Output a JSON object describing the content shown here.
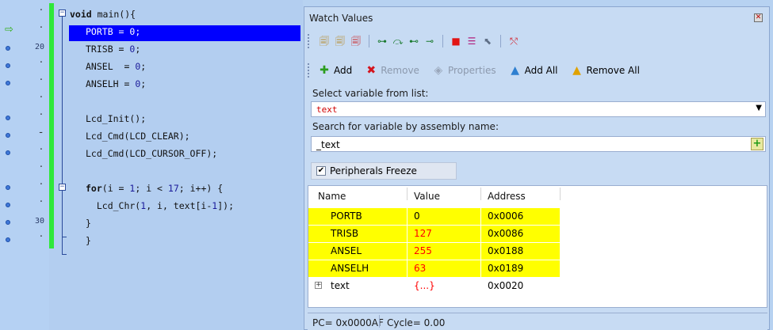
{
  "editor": {
    "lines": [
      {
        "gutter": "dot",
        "code": [
          {
            "t": "void",
            "kw": true
          },
          {
            "t": " main(){"
          }
        ]
      },
      {
        "gutter": "dot",
        "arrow": true,
        "code": [
          {
            "t": "PORTB = "
          },
          {
            "t": "0",
            "num": true
          },
          {
            "t": ";"
          }
        ],
        "highlight": true
      },
      {
        "gutter": "20",
        "bp": true,
        "code": [
          {
            "t": "TRISB = "
          },
          {
            "t": "0",
            "num": true
          },
          {
            "t": ";"
          }
        ]
      },
      {
        "gutter": "dot",
        "bp": true,
        "code": [
          {
            "t": "ANSEL  = "
          },
          {
            "t": "0",
            "num": true
          },
          {
            "t": ";"
          }
        ]
      },
      {
        "gutter": "dot",
        "bp": true,
        "code": [
          {
            "t": "ANSELH = "
          },
          {
            "t": "0",
            "num": true
          },
          {
            "t": ";"
          }
        ]
      },
      {
        "gutter": "dot",
        "code": []
      },
      {
        "gutter": "dot",
        "bp": true,
        "code": [
          {
            "t": "Lcd_Init();"
          }
        ]
      },
      {
        "gutter": "dash",
        "bp": true,
        "code": [
          {
            "t": "Lcd_Cmd(LCD_CLEAR);"
          }
        ]
      },
      {
        "gutter": "dot",
        "bp": true,
        "code": [
          {
            "t": "Lcd_Cmd(LCD_CURSOR_OFF);"
          }
        ]
      },
      {
        "gutter": "dot",
        "code": []
      },
      {
        "gutter": "dot",
        "bp": true,
        "code": [
          {
            "t": "for",
            "kw": true
          },
          {
            "t": "(i = "
          },
          {
            "t": "1",
            "num": true
          },
          {
            "t": "; i < "
          },
          {
            "t": "17",
            "num": true
          },
          {
            "t": "; i++) {"
          }
        ]
      },
      {
        "gutter": "dot",
        "bp": true,
        "code": [
          {
            "t": "  Lcd_Chr("
          },
          {
            "t": "1",
            "num": true
          },
          {
            "t": ", i, text[i-"
          },
          {
            "t": "1",
            "num": true
          },
          {
            "t": "]);"
          }
        ]
      },
      {
        "gutter": "30",
        "bp": true,
        "code": [
          {
            "t": "}"
          }
        ]
      },
      {
        "gutter": "dot",
        "bp": true,
        "code": [
          {
            "t": "}"
          }
        ]
      }
    ]
  },
  "watch": {
    "title": "Watch Values",
    "toolbar2": {
      "add": "Add",
      "remove": "Remove",
      "properties": "Properties",
      "add_all": "Add All",
      "remove_all": "Remove All"
    },
    "select_label": "Select variable from list:",
    "selected_var": "text",
    "search_label": "Search for variable by assembly name:",
    "search_value": "_text",
    "freeze_label": "Peripherals Freeze",
    "splitter_glyph": ",,,,,,,,,",
    "columns": {
      "name": "Name",
      "value": "Value",
      "address": "Address"
    },
    "rows": [
      {
        "name": "PORTB",
        "value": "0",
        "address": "0x0006",
        "yellow": true,
        "red": false
      },
      {
        "name": "TRISB",
        "value": "127",
        "address": "0x0086",
        "yellow": true,
        "red": true
      },
      {
        "name": "ANSEL",
        "value": "255",
        "address": "0x0188",
        "yellow": true,
        "red": true
      },
      {
        "name": "ANSELH",
        "value": "63",
        "address": "0x0189",
        "yellow": true,
        "red": true
      },
      {
        "name": "text",
        "value": "{...}",
        "address": "0x0020",
        "yellow": false,
        "red": true,
        "expandable": true
      }
    ],
    "status": {
      "pc": "PC= 0x0000AF",
      "cycle": "Cycle= 0.00"
    }
  },
  "colors": {
    "highlight": "#0000ff",
    "yellow": "#ffff00",
    "red": "#ff0000",
    "green_bar": "#2fe83a"
  }
}
